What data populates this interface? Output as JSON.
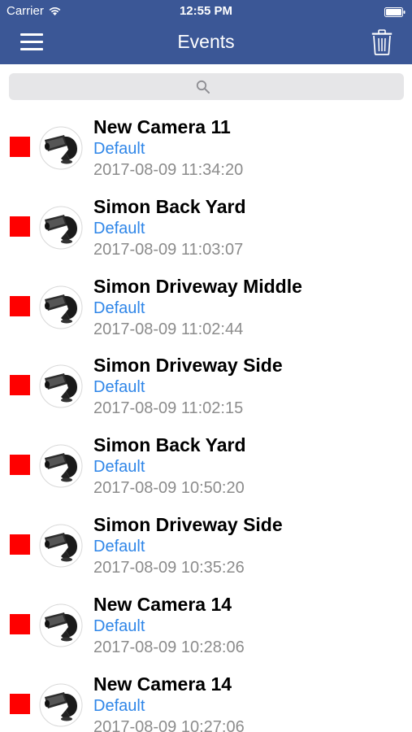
{
  "status_bar": {
    "carrier": "Carrier",
    "time": "12:55 PM"
  },
  "nav": {
    "title": "Events",
    "menu_icon": "hamburger-menu-icon",
    "trash_icon": "trash-icon"
  },
  "search": {
    "placeholder": "",
    "icon": "magnifier-icon"
  },
  "colors": {
    "nav_bar": "#3b5796",
    "status_indicator": "#ff0000",
    "group_link": "#2f86e8",
    "timestamp": "#8c8c8c"
  },
  "events": [
    {
      "name": "New Camera 11",
      "group": "Default",
      "time": "2017-08-09 11:34:20"
    },
    {
      "name": "Simon Back Yard",
      "group": "Default",
      "time": "2017-08-09 11:03:07"
    },
    {
      "name": "Simon Driveway Middle",
      "group": "Default",
      "time": "2017-08-09 11:02:44"
    },
    {
      "name": "Simon Driveway Side",
      "group": "Default",
      "time": "2017-08-09 11:02:15"
    },
    {
      "name": "Simon Back Yard",
      "group": "Default",
      "time": "2017-08-09 10:50:20"
    },
    {
      "name": "Simon Driveway Side",
      "group": "Default",
      "time": "2017-08-09 10:35:26"
    },
    {
      "name": "New Camera 14",
      "group": "Default",
      "time": "2017-08-09 10:28:06"
    },
    {
      "name": "New Camera 14",
      "group": "Default",
      "time": "2017-08-09 10:27:06"
    }
  ]
}
